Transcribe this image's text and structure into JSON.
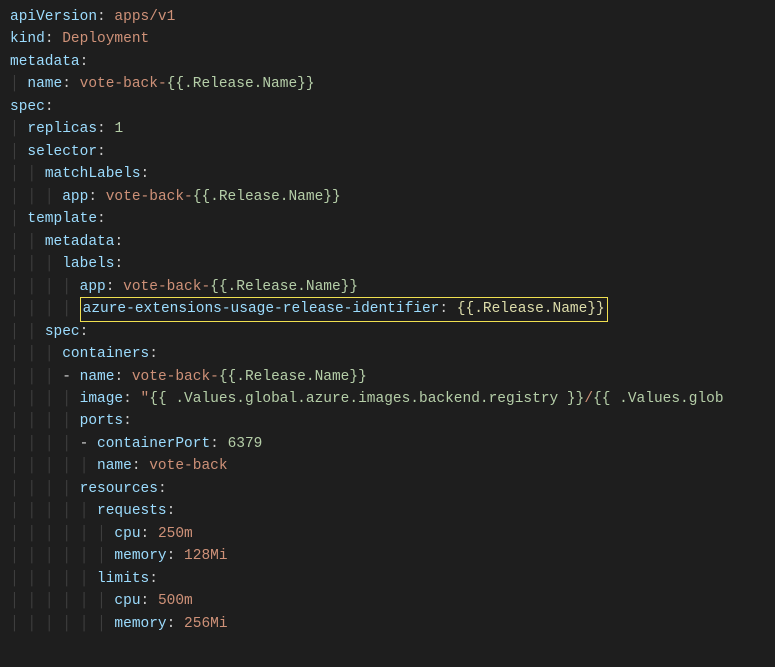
{
  "doc": {
    "apiVersion": {
      "key": "apiVersion",
      "value": "apps/v1"
    },
    "kind": {
      "key": "kind",
      "value": "Deployment"
    },
    "metadata": {
      "key": "metadata"
    },
    "metaName": {
      "key": "name",
      "value": "vote-back-",
      "tmpl": "{{.Release.Name}}"
    },
    "spec": {
      "key": "spec"
    },
    "replicas": {
      "key": "replicas",
      "value": "1"
    },
    "selector": {
      "key": "selector"
    },
    "matchLabels": {
      "key": "matchLabels"
    },
    "appSel": {
      "key": "app",
      "value": "vote-back-",
      "tmpl": "{{.Release.Name}}"
    },
    "template": {
      "key": "template"
    },
    "tmplMeta": {
      "key": "metadata"
    },
    "labels": {
      "key": "labels"
    },
    "appLbl": {
      "key": "app",
      "value": "vote-back-",
      "tmpl": "{{.Release.Name}}"
    },
    "azureId": {
      "key": "azure-extensions-usage-release-identifier",
      "tmpl": "{{.Release.Name}}"
    },
    "tmplSpec": {
      "key": "spec"
    },
    "containers": {
      "key": "containers"
    },
    "cName": {
      "key": "name",
      "value": "vote-back-",
      "tmpl": "{{.Release.Name}}"
    },
    "image": {
      "key": "image",
      "quote": "\"",
      "p1": "{{ .Values.global.azure.images.backend.registry }}",
      "sep": "/",
      "p2": "{{ .Values.glob"
    },
    "ports": {
      "key": "ports"
    },
    "containerPort": {
      "key": "containerPort",
      "value": "6379"
    },
    "portName": {
      "key": "name",
      "value": "vote-back"
    },
    "resources": {
      "key": "resources"
    },
    "requests": {
      "key": "requests"
    },
    "reqCpu": {
      "key": "cpu",
      "value": "250m"
    },
    "reqMem": {
      "key": "memory",
      "value": "128Mi"
    },
    "limits": {
      "key": "limits"
    },
    "limCpu": {
      "key": "cpu",
      "value": "500m"
    },
    "limMem": {
      "key": "memory",
      "value": "256Mi"
    }
  },
  "guides": {
    "g1": "│ ",
    "g2": "│ │ ",
    "g3": "│ │ │ ",
    "g4": "│ │ │ │ ",
    "g5": "│ │ │ │ │ ",
    "g6": "│ │ │ │ │ │ ",
    "g6d": "│ │ │ │ │ ",
    "g7": "│ │ │ │ │ │ │ ",
    "g7d": "│ │ │ │ │ │ "
  },
  "colon": ":",
  "dash": "- "
}
